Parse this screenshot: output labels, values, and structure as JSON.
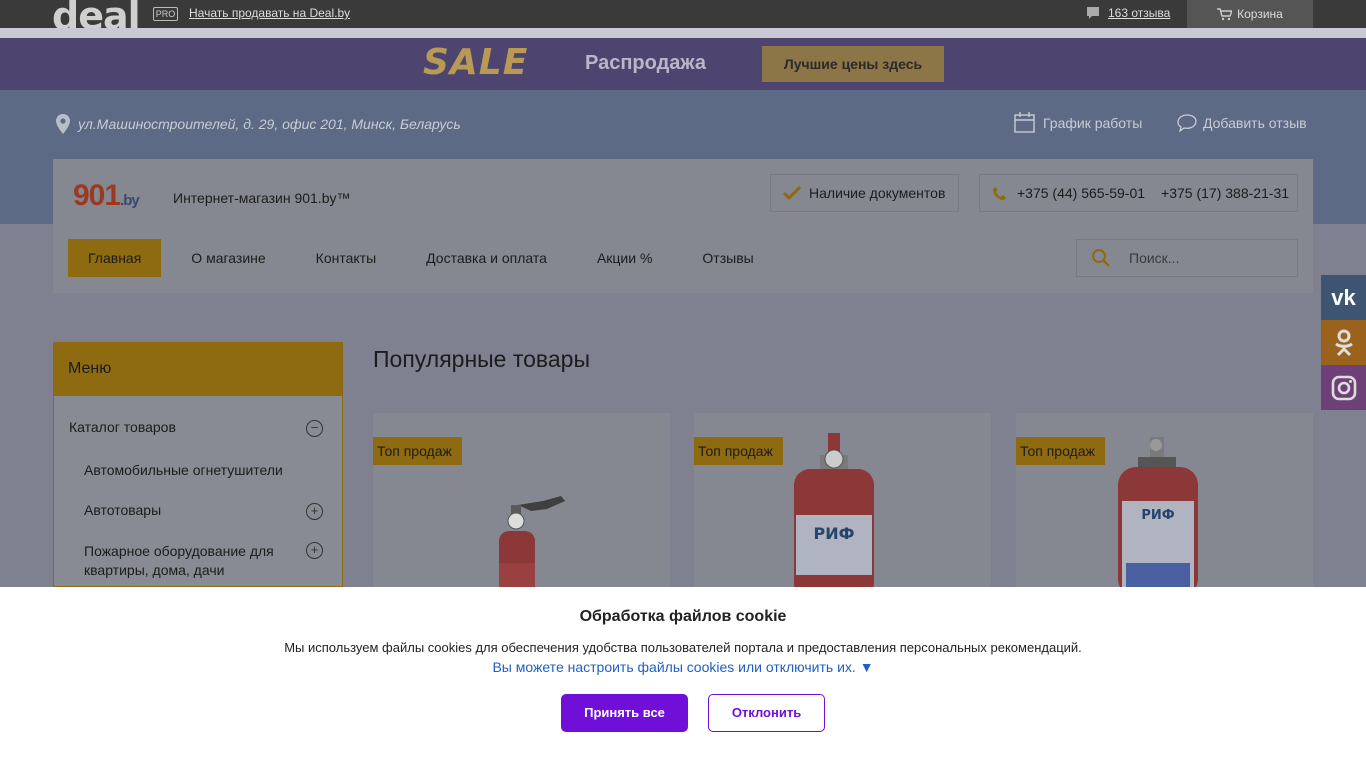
{
  "topbar": {
    "logo": "deal",
    "pro_badge": "PRO",
    "sell_link": "Начать продавать на Deal.by",
    "reviews": "163 отзыва",
    "cart": "Корзина"
  },
  "sale_banner": {
    "sale_word": "SALE",
    "title": "Распродажа",
    "button": "Лучшие цены здесь"
  },
  "header": {
    "address": "ул.Машиностроителей, д. 29, офис 201, Минск, Беларусь",
    "schedule": "График работы",
    "add_review": "Добавить отзыв"
  },
  "card": {
    "brand": "901",
    "brand_suffix": ".by",
    "shop_name": "Интернет-магазин 901.by™",
    "docs": "Наличие документов",
    "phones": [
      "+375 (44) 565-59-01",
      "+375 (17) 388-21-31"
    ],
    "nav": [
      {
        "label": "Главная",
        "active": true
      },
      {
        "label": "О магазине",
        "active": false
      },
      {
        "label": "Контакты",
        "active": false
      },
      {
        "label": "Доставка и оплата",
        "active": false
      },
      {
        "label": "Акции %",
        "active": false
      },
      {
        "label": "Отзывы",
        "active": false
      }
    ],
    "search_placeholder": "Поиск..."
  },
  "menu": {
    "title": "Меню",
    "catalog": "Каталог товаров",
    "items": [
      "Автомобильные огнетушители",
      "Автотовары",
      "Пожарное оборудование для квартиры, дома, дачи"
    ]
  },
  "popular": {
    "title": "Популярные товары",
    "badge": "Топ продаж",
    "product_label": "РИФ"
  },
  "cookie": {
    "title": "Обработка файлов cookie",
    "text": "Мы используем файлы cookies для обеспечения удобства пользователей портала и предоставления персональных рекомендаций.",
    "link": "Вы можете настроить файлы cookies или отключить их.",
    "accept": "Принять все",
    "decline": "Отклонить"
  },
  "colors": {
    "accent": "#6f0fd8",
    "link": "#1f5fc4",
    "shop_yellow": "#e6ae14"
  }
}
